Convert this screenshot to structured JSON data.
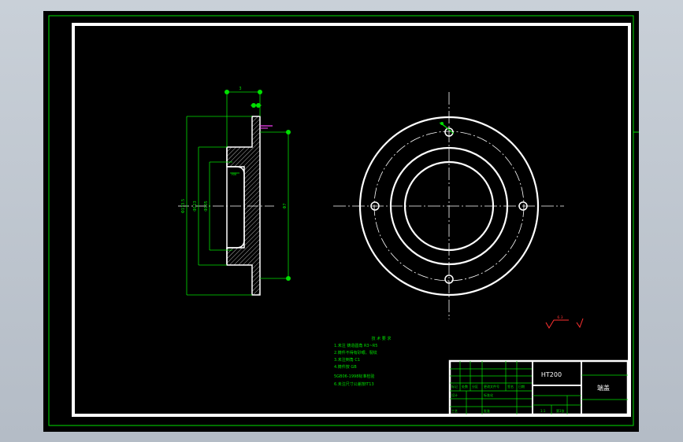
{
  "drawing": {
    "dim_labels": {
      "thickness_top": "3",
      "od_left": "Φ173.5",
      "bore_left": "Φ123",
      "step_left": "Φ105",
      "od_right": "Φ7",
      "fillet": "R8"
    },
    "notes": {
      "title": "技 术 要 求",
      "lines": [
        "1.未注 铸造圆角 R3~R5",
        "2.铸件不得有砂眼、裂纹",
        "3.未注倒角 C1",
        "4.铸件按 GB",
        "5GB06-1998标准检验",
        "6.未注尺寸公差按IT13"
      ]
    },
    "roughness": {
      "value": "6.3"
    },
    "title_block": {
      "material": "HT200",
      "part_name": "端盖",
      "scale_a": "1:1",
      "scale_b": "第1张",
      "small_cells": [
        "标记",
        "处数",
        "分区",
        "更改文件号",
        "签名",
        "日期"
      ],
      "design_row": [
        "设计",
        "标准化"
      ],
      "approve_row": [
        "工艺",
        "批准"
      ]
    }
  }
}
